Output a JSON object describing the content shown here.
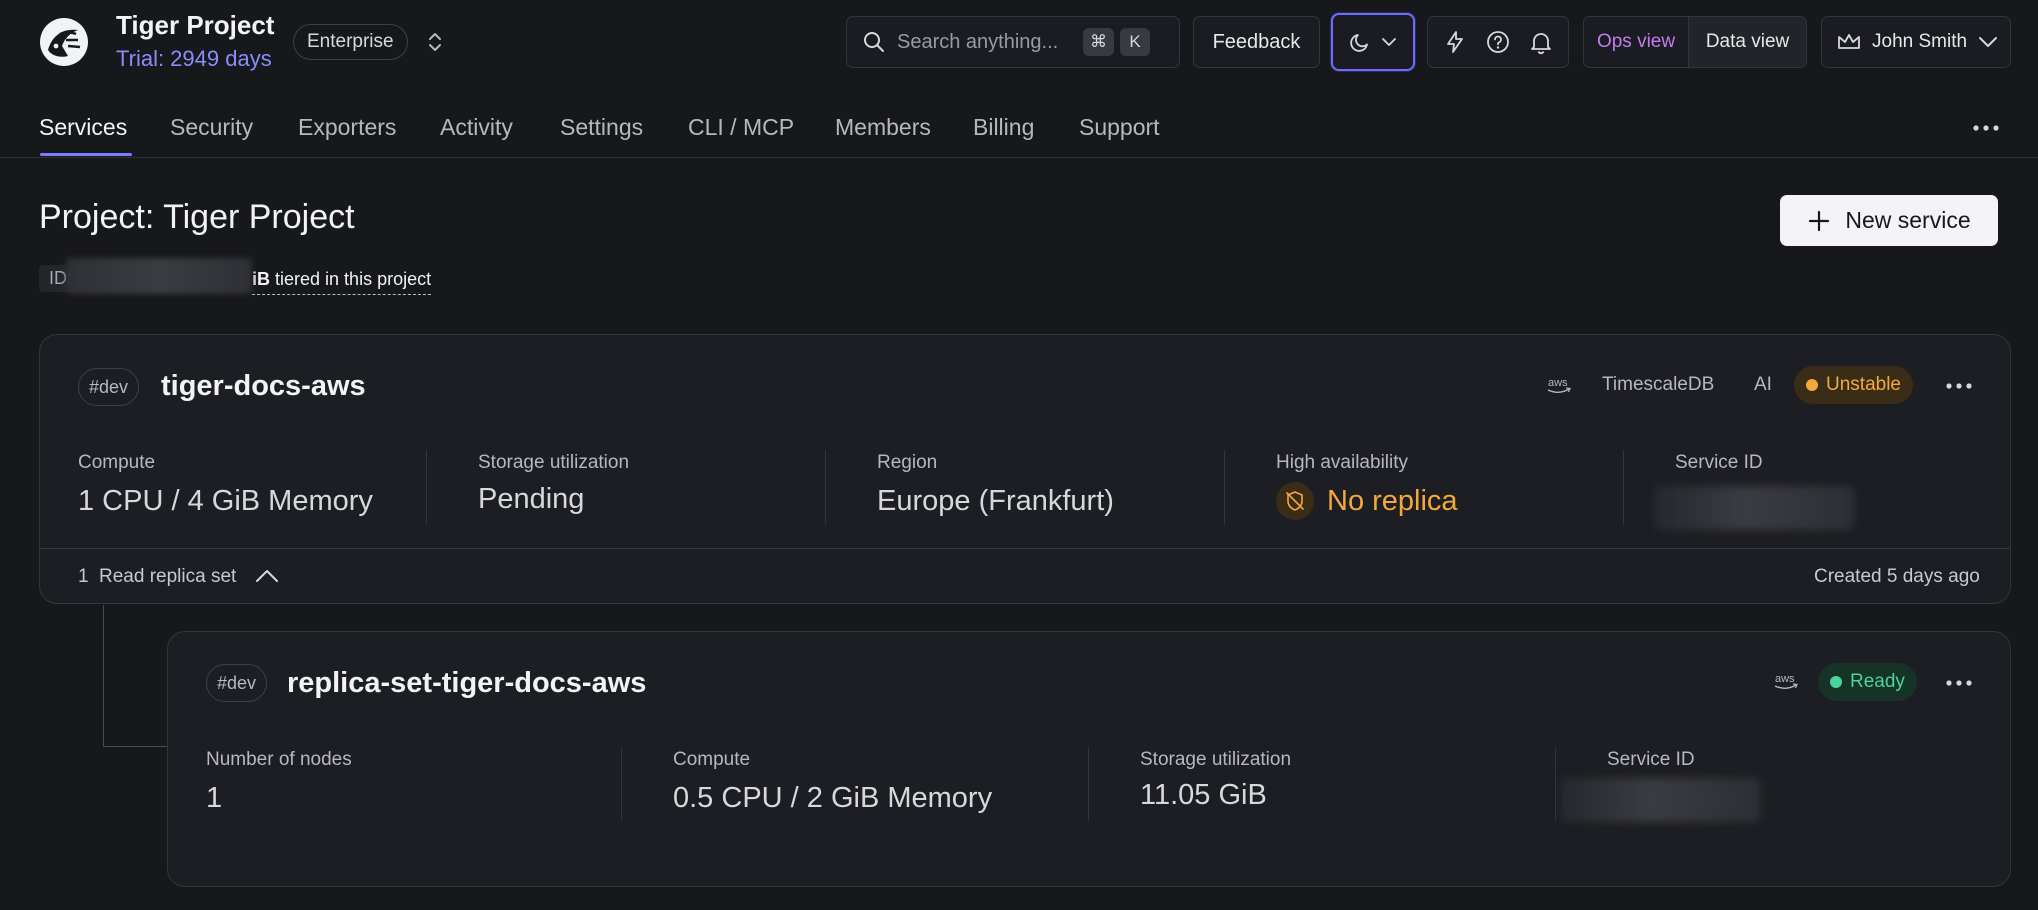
{
  "header": {
    "project_name": "Tiger Project",
    "trial": "Trial: 2949 days",
    "plan": "Enterprise",
    "search_placeholder": "Search anything...",
    "search_kbd_mod": "⌘",
    "search_kbd_key": "K",
    "feedback_label": "Feedback",
    "ops_view_label": "Ops view",
    "data_view_label": "Data view",
    "user_name": "John Smith",
    "accent_color": "#7b7dff"
  },
  "tabs": [
    {
      "label": "Services",
      "active": true
    },
    {
      "label": "Security"
    },
    {
      "label": "Exporters"
    },
    {
      "label": "Activity"
    },
    {
      "label": "Settings"
    },
    {
      "label": "CLI / MCP"
    },
    {
      "label": "Members"
    },
    {
      "label": "Billing"
    },
    {
      "label": "Support"
    }
  ],
  "page": {
    "title": "Project: Tiger Project",
    "id_prefix": "ID: v",
    "tiered_tail": "iB",
    "tiered_text": " tiered in this project",
    "new_service_label": "New service"
  },
  "service": {
    "env": "#dev",
    "name": "tiger-docs-aws",
    "provider_icon": "aws-icon",
    "engine": "TimescaleDB",
    "ai": "AI",
    "status": "Unstable",
    "status_color": "#f4a73a",
    "stats": {
      "compute_label": "Compute",
      "compute_value": "1 CPU / 4 GiB Memory",
      "storage_label": "Storage utilization",
      "storage_value": "Pending",
      "region_label": "Region",
      "region_value": "Europe (Frankfurt)",
      "ha_label": "High availability",
      "ha_value": "No replica",
      "service_id_label": "Service ID"
    },
    "footer": {
      "replica_count": "1",
      "replica_label": "Read replica set",
      "created": "Created 5 days ago"
    }
  },
  "replica": {
    "env": "#dev",
    "name": "replica-set-tiger-docs-aws",
    "provider_icon": "aws-icon",
    "status": "Ready",
    "status_color": "#48d49a",
    "stats": {
      "nodes_label": "Number of nodes",
      "nodes_value": "1",
      "compute_label": "Compute",
      "compute_value": "0.5 CPU / 2 GiB Memory",
      "storage_label": "Storage utilization",
      "storage_value": "11.05 GiB",
      "service_id_label": "Service ID"
    }
  }
}
